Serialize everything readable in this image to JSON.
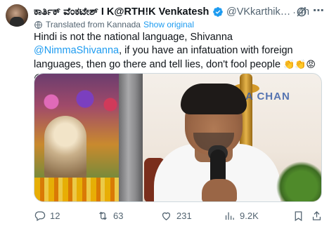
{
  "tweet": {
    "author_name": "ಕಾರ್ತಿಕ್ ವೆಂಕಟೇಶ್ I K@RTH!K Venkatesh…",
    "handle": "@VKkarthik…",
    "separator": "·",
    "time": "4h",
    "translated_label": "Translated from Kannada",
    "show_original": "Show original",
    "text_part1": "Hindi is not the national language, Shivanna ",
    "mention": "@NimmaShivanna",
    "text_part2": ", if you have an infatuation with foreign languages, then go there and tell lies, don't fool people ",
    "emojis": "👏👏😡😡",
    "media_banner_text": "A CHAN"
  },
  "actions": {
    "replies": "12",
    "retweets": "63",
    "likes": "231",
    "views": "9.2K"
  },
  "colors": {
    "accent": "#1d9bf0",
    "secondary_text": "#536471",
    "primary_text": "#0f1419"
  },
  "icons": {
    "verified": "verified-badge-icon",
    "grok": "grok-icon",
    "more": "more-icon",
    "translate": "translate-icon",
    "reply": "reply-icon",
    "retweet": "retweet-icon",
    "like": "heart-icon",
    "views": "views-icon",
    "bookmark": "bookmark-icon",
    "share": "share-icon"
  }
}
